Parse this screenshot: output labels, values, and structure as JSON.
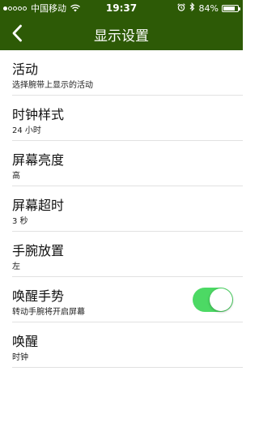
{
  "status_bar": {
    "signal_dots_filled": 1,
    "signal_dots_total": 5,
    "carrier": "中国移动",
    "time": "19:37",
    "battery": "84%",
    "battery_level": 0.84,
    "icons": [
      "wifi-icon",
      "alarm-icon",
      "bluetooth-icon",
      "battery-icon"
    ]
  },
  "nav": {
    "title": "显示设置",
    "back_icon": "chevron-left-icon"
  },
  "colors": {
    "nav_background": "#2d5a06",
    "toggle_on": "#4cd964",
    "divider": "#e1e1e1"
  },
  "settings": [
    {
      "key": "activity",
      "title": "活动",
      "subtitle": "选择腕带上显示的活动"
    },
    {
      "key": "clock-style",
      "title": "时钟样式",
      "subtitle": "24 小时"
    },
    {
      "key": "screen-brightness",
      "title": "屏幕亮度",
      "subtitle": "高"
    },
    {
      "key": "screen-timeout",
      "title": "屏幕超时",
      "subtitle": "3 秒"
    },
    {
      "key": "wrist-placement",
      "title": "手腕放置",
      "subtitle": "左"
    },
    {
      "key": "wake-gesture",
      "title": "唤醒手势",
      "subtitle": "转动手腕将开启屏幕",
      "toggle": true,
      "toggle_on": true
    },
    {
      "key": "wake",
      "title": "唤醒",
      "subtitle": "时钟"
    }
  ]
}
